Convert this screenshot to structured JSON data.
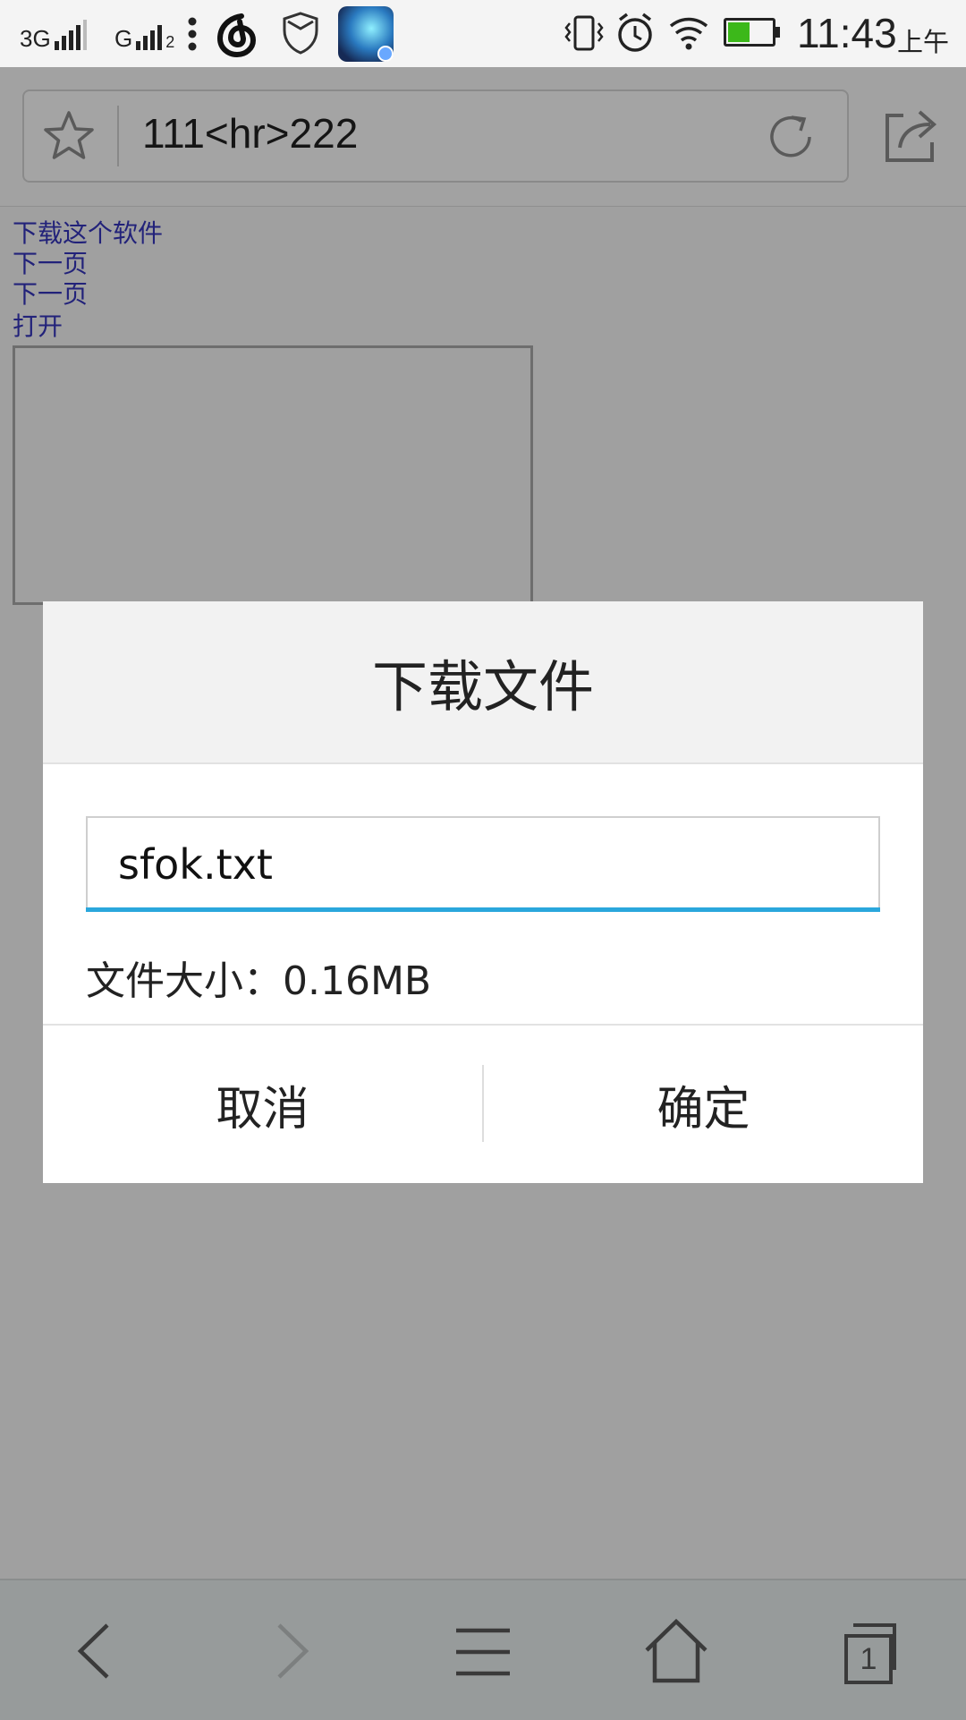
{
  "status_bar": {
    "network_1": "3G",
    "network_2": "G",
    "sim_2_index": "2",
    "time": "11:43",
    "am_pm": "上午",
    "icons": [
      "netease-music-icon",
      "shield-icon",
      "game-app-icon",
      "vibrate-icon",
      "alarm-icon",
      "wifi-icon",
      "battery-icon"
    ],
    "battery_level": 0.5,
    "battery_color": "#3cb81a"
  },
  "browser": {
    "url": "111<hr>222",
    "icons": [
      "star-icon",
      "refresh-icon",
      "share-icon"
    ]
  },
  "page": {
    "links": [
      "下载这个软件",
      "下一页",
      "下一页",
      "打开"
    ]
  },
  "dialog": {
    "title": "下载文件",
    "filename": "sfok.txt",
    "file_size_label": "文件大小：",
    "file_size_value": "0.16MB",
    "cancel_label": "取消",
    "confirm_label": "确定",
    "accent_color": "#2aa7dc"
  },
  "bottom_nav": {
    "icons": [
      "back-icon",
      "forward-icon",
      "menu-icon",
      "home-icon",
      "tabs-icon"
    ],
    "tab_count": "1"
  }
}
